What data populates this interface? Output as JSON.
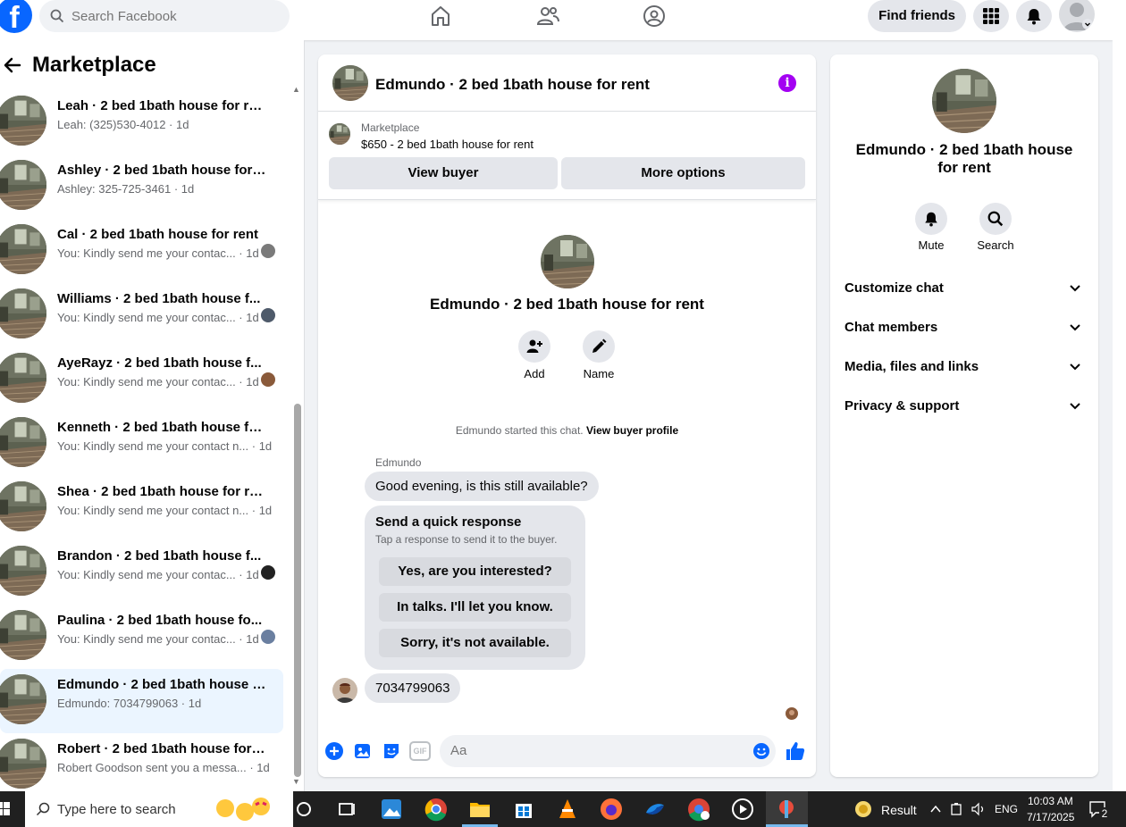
{
  "topbar": {
    "logo": "f",
    "search_placeholder": "Search Facebook",
    "find_friends": "Find friends"
  },
  "sidebar": {
    "title": "Marketplace",
    "conversations": [
      {
        "title": "Leah · 2 bed 1bath house for rent",
        "sub": "Leah: (325)530-4012 · 1d",
        "mini": false
      },
      {
        "title": "Ashley · 2 bed 1bath house for r...",
        "sub": "Ashley: 325-725-3461 · 1d",
        "mini": false
      },
      {
        "title": "Cal · 2 bed 1bath house for rent",
        "sub": "You: Kindly send me your contac... · 1d",
        "mini": true,
        "mini_color": "#7a7a7a"
      },
      {
        "title": "Williams · 2 bed 1bath house f...",
        "sub": "You: Kindly send me your contac... · 1d",
        "mini": true,
        "mini_color": "#4e5a6a"
      },
      {
        "title": "AyeRayz · 2 bed 1bath house f...",
        "sub": "You: Kindly send me your contac... · 1d",
        "mini": true,
        "mini_color": "#8a5a3a"
      },
      {
        "title": "Kenneth · 2 bed 1bath house for...",
        "sub": "You: Kindly send me your contact n... · 1d",
        "mini": false
      },
      {
        "title": "Shea · 2 bed 1bath house for rent",
        "sub": "You: Kindly send me your contact n... · 1d",
        "mini": false
      },
      {
        "title": "Brandon · 2 bed 1bath house f...",
        "sub": "You: Kindly send me your contac... · 1d",
        "mini": true,
        "mini_color": "#222222"
      },
      {
        "title": "Paulina · 2 bed 1bath house fo...",
        "sub": "You: Kindly send me your contac... · 1d",
        "mini": true,
        "mini_color": "#6a7fa0"
      },
      {
        "title": "Edmundo · 2 bed 1bath house fo...",
        "sub": "Edmundo: 7034799063 · 1d",
        "mini": false,
        "active": true
      },
      {
        "title": "Robert · 2 bed 1bath house for r...",
        "sub": "Robert Goodson sent you a messa... · 1d",
        "mini": false
      }
    ]
  },
  "chat": {
    "header_name": "Edmundo · 2 bed 1bath house for rent",
    "info_icon": "i",
    "mp_label": "Marketplace",
    "mp_listing": "$650 - 2 bed 1bath house for rent",
    "view_buyer": "View buyer",
    "more_options": "More options",
    "center_name": "Edmundo · 2 bed 1bath house for rent",
    "add_label": "Add",
    "name_label": "Name",
    "started_text": "Edmundo started this chat.",
    "started_link": "View buyer profile",
    "sender": "Edmundo",
    "message1": "Good evening, is this still available?",
    "quick_title": "Send a quick response",
    "quick_sub": "Tap a response to send it to the buyer.",
    "quick_options": [
      "Yes, are you interested?",
      "In talks. I'll let you know.",
      "Sorry, it's not available."
    ],
    "message2": "7034799063",
    "composer_placeholder": "Aa",
    "gif_label": "GIF"
  },
  "rpanel": {
    "name": "Edmundo · 2 bed 1bath house for rent",
    "mute": "Mute",
    "search": "Search",
    "rows": [
      "Customize chat",
      "Chat members",
      "Media, files and links",
      "Privacy & support"
    ]
  },
  "taskbar": {
    "search_placeholder": "Type here to search",
    "result_label": "Result",
    "lang": "ENG",
    "time": "10:03 AM",
    "date": "7/17/2025",
    "notif_count": "2"
  },
  "colors": {
    "brand": "#0866ff",
    "accent_purple": "#a301f2",
    "active_bg": "#ebf5ff"
  }
}
